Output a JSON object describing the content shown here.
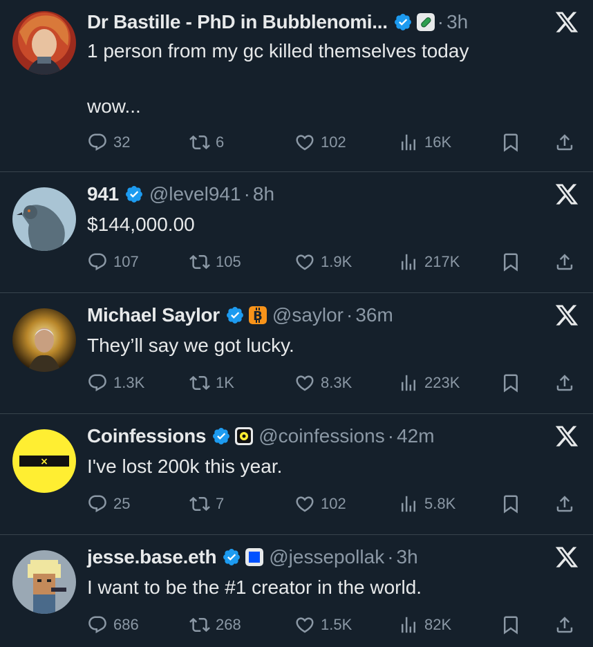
{
  "tweets": [
    {
      "name": "Dr Bastille - PhD in Bubblenomi...",
      "handle": "",
      "time": "3h",
      "badge": "pill",
      "text": "1 person from my gc killed themselves today\n\nwow...",
      "replies": "32",
      "retweets": "6",
      "likes": "102",
      "views": "16K"
    },
    {
      "name": "941",
      "handle": "@level941",
      "time": "8h",
      "badge": "",
      "text": "$144,000.00",
      "replies": "107",
      "retweets": "105",
      "likes": "1.9K",
      "views": "217K"
    },
    {
      "name": "Michael Saylor",
      "handle": "@saylor",
      "time": "36m",
      "badge": "bitcoin",
      "text": "They’ll say we got lucky.",
      "replies": "1.3K",
      "retweets": "1K",
      "likes": "8.3K",
      "views": "223K"
    },
    {
      "name": "Coinfessions",
      "handle": "@coinfessions",
      "time": "42m",
      "badge": "coinfessions",
      "text": "I've lost 200k this year.",
      "replies": "25",
      "retweets": "7",
      "likes": "102",
      "views": "5.8K"
    },
    {
      "name": "jesse.base.eth",
      "handle": "@jessepollak",
      "time": "3h",
      "badge": "base",
      "text": "I want to be the #1 creator in the world.",
      "replies": "686",
      "retweets": "268",
      "likes": "1.5K",
      "views": "82K"
    }
  ],
  "avatar_marks": {
    "coinfessions": "×"
  },
  "colors": {
    "background": "#15202b",
    "verified": "#1d9bf0",
    "muted": "#8b98a5",
    "divider": "#38444d",
    "bitcoin": "#f7931a",
    "base_blue": "#0052ff",
    "coinfessions_yellow": "#ffee32"
  }
}
